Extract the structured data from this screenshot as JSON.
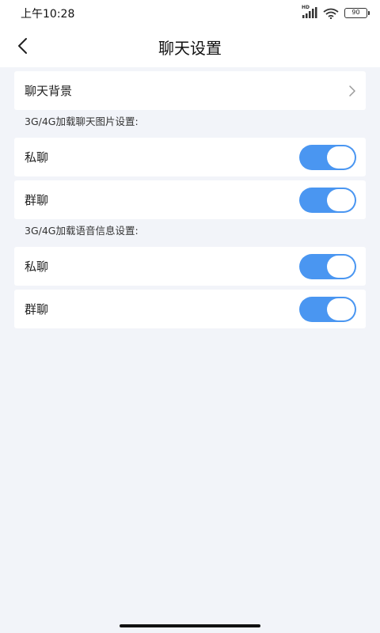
{
  "status_bar": {
    "time": "上午10:28",
    "network_badge": "HD",
    "battery": "90",
    "icons": [
      "signal-icon",
      "wifi-icon",
      "battery-icon"
    ]
  },
  "header": {
    "title": "聊天设置",
    "back_icon": "chevron-left-icon"
  },
  "chat_background": {
    "label": "聊天背景",
    "arrow_icon": "chevron-right-icon"
  },
  "image_settings": {
    "section_label": "3G/4G加载聊天图片设置:",
    "items": [
      {
        "label": "私聊",
        "enabled": true
      },
      {
        "label": "群聊",
        "enabled": true
      }
    ]
  },
  "voice_settings": {
    "section_label": "3G/4G加载语音信息设置:",
    "items": [
      {
        "label": "私聊",
        "enabled": true
      },
      {
        "label": "群聊",
        "enabled": true
      }
    ]
  },
  "colors": {
    "accent": "#4a96f1",
    "background": "#f2f4f9",
    "card": "#ffffff"
  }
}
